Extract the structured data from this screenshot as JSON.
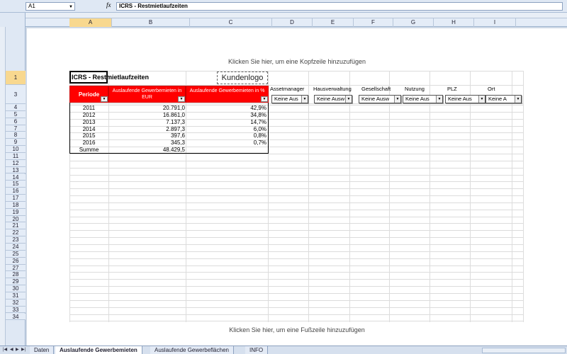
{
  "formula_bar": {
    "cell_ref": "A1",
    "formula": "ICRS - Restmietlaufzeiten"
  },
  "columns": [
    {
      "label": "A",
      "selected": true
    },
    {
      "label": "B"
    },
    {
      "label": "C"
    },
    {
      "label": "D"
    },
    {
      "label": "E"
    },
    {
      "label": "F"
    },
    {
      "label": "G"
    },
    {
      "label": "H"
    },
    {
      "label": "I"
    }
  ],
  "rows": [
    "1",
    "3",
    "4",
    "5",
    "6",
    "7",
    "8",
    "9",
    "10",
    "11",
    "12",
    "13",
    "14",
    "15",
    "16",
    "17",
    "18",
    "19",
    "20",
    "21",
    "22",
    "23",
    "24",
    "25",
    "26",
    "27",
    "28",
    "29",
    "30",
    "31",
    "32",
    "33",
    "34"
  ],
  "page": {
    "header_hint": "Klicken Sie hier, um eine Kopfzeile hinzuzufügen",
    "footer_hint": "Klicken Sie hier, um eine Fußzeile hinzuzufügen",
    "title": "ICRS - Restmietlaufzeiten",
    "logo": "Kundenlogo"
  },
  "table": {
    "headers": {
      "periode": "Periode",
      "col_b": "Auslaufende Gewerbemieten in EUR",
      "col_c": "Auslaufende Gewerbemieten in %"
    },
    "rows": [
      {
        "year": "2011",
        "eur": "20.791,0",
        "pct": "42,9%"
      },
      {
        "year": "2012",
        "eur": "16.861,0",
        "pct": "34,8%"
      },
      {
        "year": "2013",
        "eur": "7.137,3",
        "pct": "14,7%"
      },
      {
        "year": "2014",
        "eur": "2.897,3",
        "pct": "6,0%"
      },
      {
        "year": "2015",
        "eur": "397,6",
        "pct": "0,8%"
      },
      {
        "year": "2016",
        "eur": "345,3",
        "pct": "0,7%"
      }
    ],
    "sum_label": "Summe",
    "sum_value": "48.429,5"
  },
  "slicers": [
    {
      "label": "Assetmanager",
      "value": "Keine Aus"
    },
    {
      "label": "Hausverwaltung",
      "value": "Keine Ausw"
    },
    {
      "label": "Gesellschaft",
      "value": "Keine Ausw"
    },
    {
      "label": "Nutzung",
      "value": "Keine Aus"
    },
    {
      "label": "PLZ",
      "value": "Keine Aus"
    },
    {
      "label": "Ort",
      "value": "Keine A"
    }
  ],
  "sheet_tabs": [
    {
      "label": "Daten"
    },
    {
      "label": "Auslaufende Gewerbemieten",
      "active": true
    },
    {
      "label": "Auslaufende Gewerbeflächen"
    },
    {
      "label": "INFO"
    }
  ]
}
